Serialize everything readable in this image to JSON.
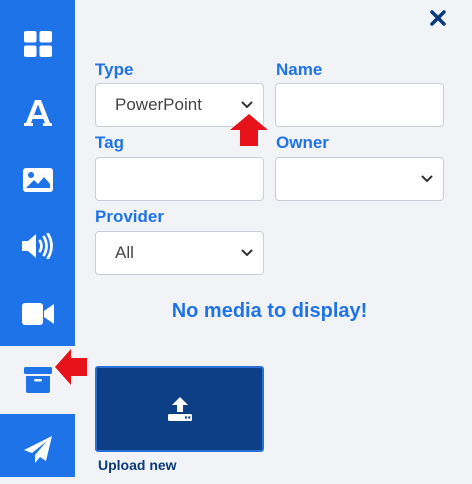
{
  "sidebar": {
    "items": [
      {
        "name": "grid-icon"
      },
      {
        "name": "text-icon"
      },
      {
        "name": "image-icon"
      },
      {
        "name": "audio-icon"
      },
      {
        "name": "video-icon"
      },
      {
        "name": "archive-icon",
        "active": true
      },
      {
        "name": "send-icon"
      }
    ]
  },
  "filters": {
    "type_label": "Type",
    "type_value": "PowerPoint",
    "name_label": "Name",
    "name_value": "",
    "tag_label": "Tag",
    "tag_value": "",
    "owner_label": "Owner",
    "owner_value": "",
    "provider_label": "Provider",
    "provider_value": "All"
  },
  "main": {
    "empty_message": "No media to display!",
    "upload_label": "Upload new"
  },
  "colors": {
    "accent": "#1f73e8",
    "upload_bg": "#0d3f86",
    "annotation": "#e8121b"
  }
}
